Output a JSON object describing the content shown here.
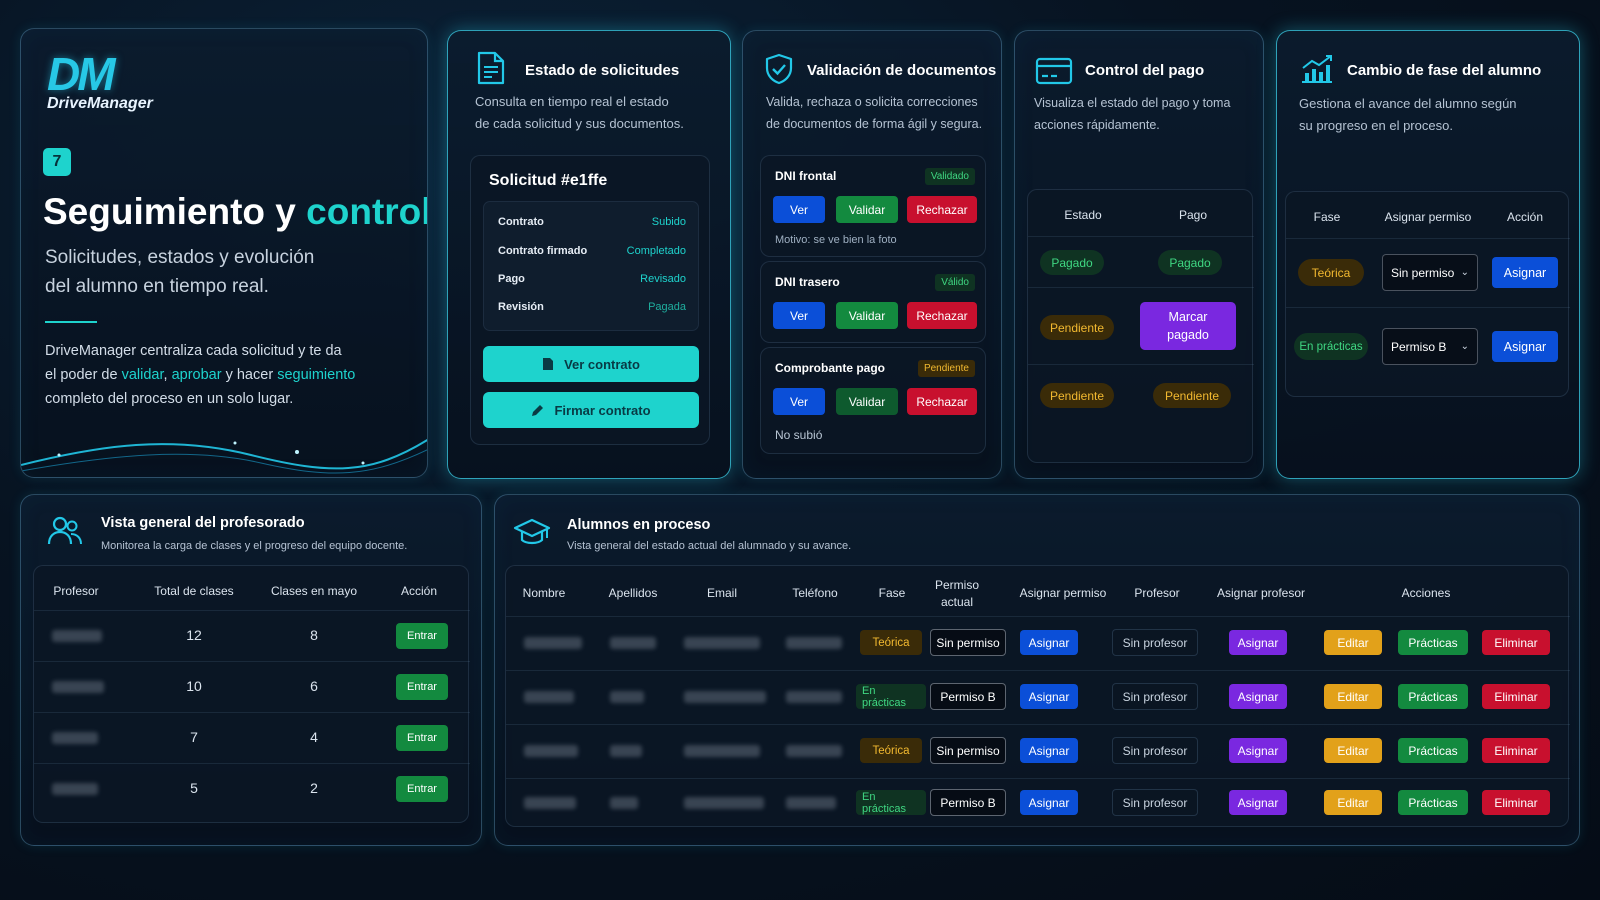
{
  "colors": {
    "accent": "#1ed3cd",
    "blue": "#0b4fd8",
    "green": "#138a3f",
    "red": "#c8102e",
    "purple": "#7a28e0",
    "yellow": "#e2a11a"
  },
  "hero": {
    "logo_mark": "DM",
    "logo_name": "DriveManager",
    "step": "7",
    "title_main": "Seguimiento y",
    "title_accent": "control",
    "subtitle_1": "Solicitudes, estados y evolución",
    "subtitle_2": "del alumno en tiempo real.",
    "body_1": "DriveManager centraliza cada solicitud y te da",
    "body_2a": "el poder de",
    "body_link_1": "validar",
    "body_comma": ",",
    "body_link_2": "aprobar",
    "body_2b": "y hacer",
    "body_link_3": "seguimiento",
    "body_3": "completo del proceso en un solo lugar."
  },
  "requests": {
    "icon": "document-icon",
    "title": "Estado de solicitudes",
    "sub_1": "Consulta en tiempo real el estado",
    "sub_2": "de cada solicitud y sus documentos.",
    "panel_title": "Solicitud #e1ffe",
    "rows": [
      {
        "label": "Contrato",
        "value": "Subido"
      },
      {
        "label": "Contrato firmado",
        "value": "Completado"
      },
      {
        "label": "Pago",
        "value": "Revisado"
      },
      {
        "label": "Revisión",
        "value": "Pagada"
      }
    ],
    "btn_view": "Ver contrato",
    "btn_sign": "Firmar contrato"
  },
  "validation": {
    "icon": "shield-check-icon",
    "title": "Validación de documentos",
    "sub_1": "Valida, rechaza o solicita correcciones",
    "sub_2": "de documentos de forma ágil y segura.",
    "docs": [
      {
        "name": "DNI frontal",
        "status": "Validado",
        "note": "Motivo: se ve bien la foto"
      },
      {
        "name": "DNI trasero",
        "status": "Válido",
        "note": ""
      },
      {
        "name": "Comprobante pago",
        "status": "Pendiente",
        "note": "No subió"
      }
    ],
    "btn_view": "Ver",
    "btn_validate": "Validar",
    "btn_reject": "Rechazar"
  },
  "payment": {
    "icon": "credit-card-icon",
    "title": "Control del pago",
    "sub_1": "Visualiza el estado del pago y toma",
    "sub_2": "acciones rápidamente.",
    "col_state": "Estado",
    "col_payment": "Pago",
    "rows": [
      {
        "state": "Pagado",
        "payment": "Pagado"
      },
      {
        "state": "Pendiente",
        "payment_action": "Marcar pagado"
      },
      {
        "state": "Pendiente",
        "payment": "Pendiente"
      }
    ]
  },
  "phase": {
    "icon": "growth-chart-icon",
    "title": "Cambio de fase del alumno",
    "sub_1": "Gestiona el avance del alumno según",
    "sub_2": "su progreso en el proceso.",
    "col_phase": "Fase",
    "col_permit": "Asignar permiso",
    "col_action": "Acción",
    "rows": [
      {
        "phase": "Teórica",
        "permit": "Sin permiso",
        "action": "Asignar"
      },
      {
        "phase": "En prácticas",
        "permit": "Permiso B",
        "action": "Asignar"
      }
    ]
  },
  "teachers": {
    "icon": "users-icon",
    "title": "Vista general del profesorado",
    "sub": "Monitorea la carga de clases y el progreso del equipo docente.",
    "headers": [
      "Profesor",
      "Total de clases",
      "Clases en mayo",
      "Acción"
    ],
    "rows": [
      {
        "total": "12",
        "may": "8",
        "action": "Entrar"
      },
      {
        "total": "10",
        "may": "6",
        "action": "Entrar"
      },
      {
        "total": "7",
        "may": "4",
        "action": "Entrar"
      },
      {
        "total": "5",
        "may": "2",
        "action": "Entrar"
      }
    ]
  },
  "students": {
    "icon": "graduation-cap-icon",
    "title": "Alumnos en proceso",
    "sub": "Vista general del estado actual del alumnado y su avance.",
    "headers": {
      "name": "Nombre",
      "surname": "Apellidos",
      "email": "Email",
      "phone": "Teléfono",
      "phase": "Fase",
      "permit_1": "Permiso",
      "permit_2": "actual",
      "assign_permit": "Asignar permiso",
      "teacher": "Profesor",
      "assign_teacher": "Asignar profesor",
      "actions": "Acciones"
    },
    "rows": [
      {
        "phase": "Teórica",
        "permit": "Sin permiso",
        "teacher": "Sin profesor"
      },
      {
        "phase": "En prácticas",
        "permit": "Permiso B",
        "teacher": "Sin profesor"
      },
      {
        "phase": "Teórica",
        "permit": "Sin permiso",
        "teacher": "Sin profesor"
      },
      {
        "phase": "En prácticas",
        "permit": "Permiso B",
        "teacher": "Sin profesor"
      }
    ],
    "btn_assign": "Asignar",
    "btn_edit": "Editar",
    "btn_practice": "Prácticas",
    "btn_delete": "Eliminar"
  }
}
